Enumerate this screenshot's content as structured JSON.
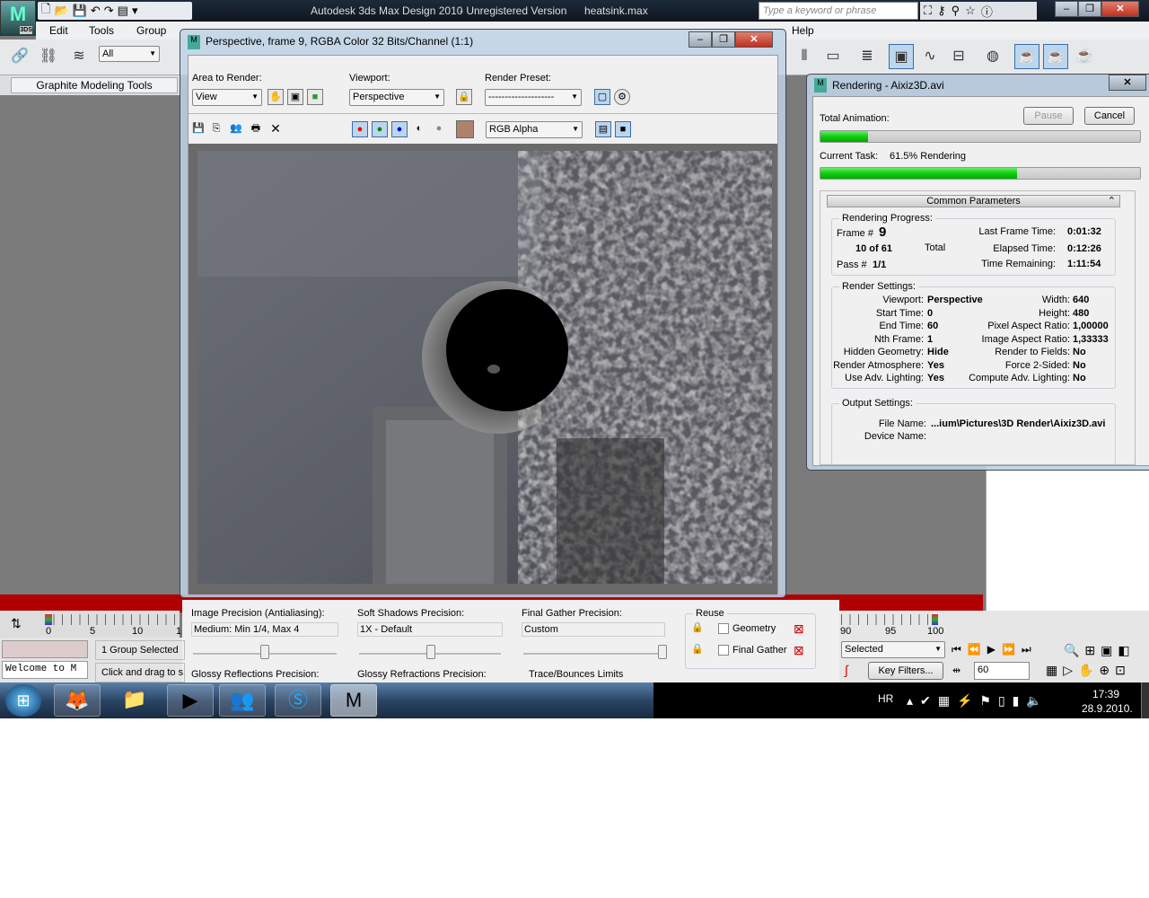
{
  "app": {
    "title": "Autodesk 3ds Max Design 2010",
    "unregistered": " - Unregistered Version",
    "file": "heatsink.max",
    "logo": "3DS",
    "search_placeholder": "Type a keyword or phrase"
  },
  "menu": [
    "Edit",
    "Tools",
    "Group",
    "Help"
  ],
  "toolbar": {
    "selection_filter": "All"
  },
  "ribbon": {
    "tab": "Graphite Modeling Tools"
  },
  "frame_window": {
    "title": "Perspective, frame 9, RGBA Color 32 Bits/Channel (1:1)",
    "area_label": "Area to Render:",
    "area_value": "View",
    "viewport_label": "Viewport:",
    "viewport_value": "Perspective",
    "preset_label": "Render Preset:",
    "preset_value": "--------------------",
    "channel_value": "RGB Alpha",
    "swatch_color": "#b08070"
  },
  "rendering_dialog": {
    "title": "Rendering - Aixiz3D.avi",
    "pause": "Pause",
    "cancel": "Cancel",
    "total_animation_label": "Total Animation:",
    "total_progress": 0.148,
    "current_task_label": "Current Task:",
    "current_task_value": "61.5%  Rendering",
    "current_progress": 0.615,
    "rollout": "Common Parameters",
    "progress_group": "Rendering Progress:",
    "frame_label": "Frame #",
    "frame": "9",
    "count": "10 of 61",
    "total_label": "Total",
    "pass_label": "Pass #",
    "pass": "1/1",
    "last_frame_label": "Last Frame Time:",
    "last_frame": "0:01:32",
    "elapsed_label": "Elapsed Time:",
    "elapsed": "0:12:26",
    "remaining_label": "Time Remaining:",
    "remaining": "1:11:54",
    "settings_group": "Render Settings:",
    "settings_left": [
      [
        "Viewport:",
        "Perspective"
      ],
      [
        "Start Time:",
        "0"
      ],
      [
        "End Time:",
        "60"
      ],
      [
        "Nth Frame:",
        "1"
      ],
      [
        "Hidden Geometry:",
        "Hide"
      ],
      [
        "Render Atmosphere:",
        "Yes"
      ],
      [
        "Use Adv. Lighting:",
        "Yes"
      ]
    ],
    "settings_right": [
      [
        "Width:",
        "640"
      ],
      [
        "Height:",
        "480"
      ],
      [
        "Pixel Aspect Ratio:",
        "1,00000"
      ],
      [
        "Image Aspect Ratio:",
        "1,33333"
      ],
      [
        "Render to Fields:",
        "No"
      ],
      [
        "Force 2-Sided:",
        "No"
      ],
      [
        "Compute Adv. Lighting:",
        "No"
      ]
    ],
    "output_group": "Output Settings:",
    "file_label": "File Name:",
    "file": "...ium\\Pictures\\3D Render\\Aixiz3D.avi",
    "device_label": "Device Name:"
  },
  "render_setup": {
    "image_precision_label": "Image Precision (Antialiasing):",
    "image_precision": "Medium: Min 1/4, Max 4",
    "soft_shadows_label": "Soft Shadows Precision:",
    "soft_shadows": "1X - Default",
    "final_gather_label": "Final Gather Precision:",
    "final_gather": "Custom",
    "glossy_refl": "Glossy Reflections Precision:",
    "glossy_refr": "Glossy Refractions Precision:",
    "trace": "Trace/Bounces Limits",
    "reuse": "Reuse",
    "geometry": "Geometry",
    "final_gather_cb": "Final Gather"
  },
  "timeline": {
    "ticks_left": [
      "0",
      "5",
      "10",
      "1"
    ],
    "ticks_right": [
      "90",
      "95",
      "100"
    ]
  },
  "status": {
    "selection": "1 Group Selected",
    "prompt": "Click and drag to s",
    "listener": "Welcome to M"
  },
  "anim": {
    "key_mode": "Selected",
    "key_filters": "Key Filters...",
    "frame": "60"
  },
  "tray": {
    "lang": "HR",
    "time": "17:39",
    "date": "28.9.2010."
  }
}
